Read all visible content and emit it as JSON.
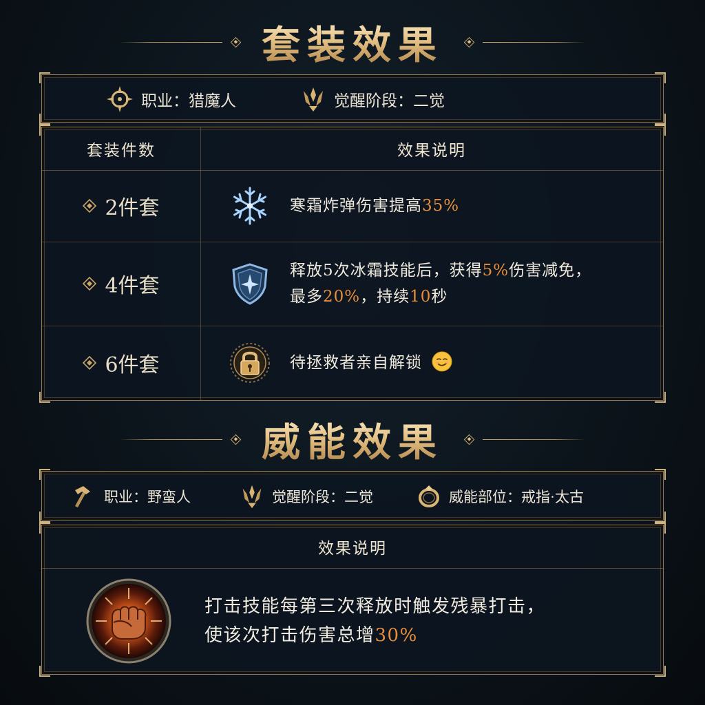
{
  "set_section": {
    "title": "套装效果",
    "class_label": "职业：猎魔人",
    "awaken_label": "觉醒阶段：二觉",
    "table": {
      "col_count": "套装件数",
      "col_effect": "效果说明",
      "rows": [
        {
          "count": "2件套",
          "icon": "snowflake-icon",
          "text_parts": [
            "寒霜炸弹伤害提高",
            "35%"
          ],
          "highlight_idx": [
            1
          ]
        },
        {
          "count": "4件套",
          "icon": "frost-shield-icon",
          "line1_parts": [
            "释放5次冰霜技能后，获得",
            "5%",
            "伤害减免，"
          ],
          "line2_parts": [
            "最多",
            "20%",
            "，持续",
            "10",
            "秒"
          ]
        },
        {
          "count": "6件套",
          "icon": "lock-icon",
          "text": "待拯救者亲自解锁",
          "emoji": "smirk-emoji"
        }
      ]
    }
  },
  "legendary_section": {
    "title": "威能效果",
    "class_label": "职业：野蛮人",
    "awaken_label": "觉醒阶段：二觉",
    "slot_label": "威能部位：戒指·太古",
    "col_effect": "效果说明",
    "icon": "fist-icon",
    "line1": "打击技能每第三次释放时触发残暴打击，",
    "line2_parts": [
      "使该次打击伤害总增",
      "30%"
    ]
  },
  "colors": {
    "gold": "#c9a668",
    "highlight": "#e88e3a",
    "background": "#0b1117"
  }
}
